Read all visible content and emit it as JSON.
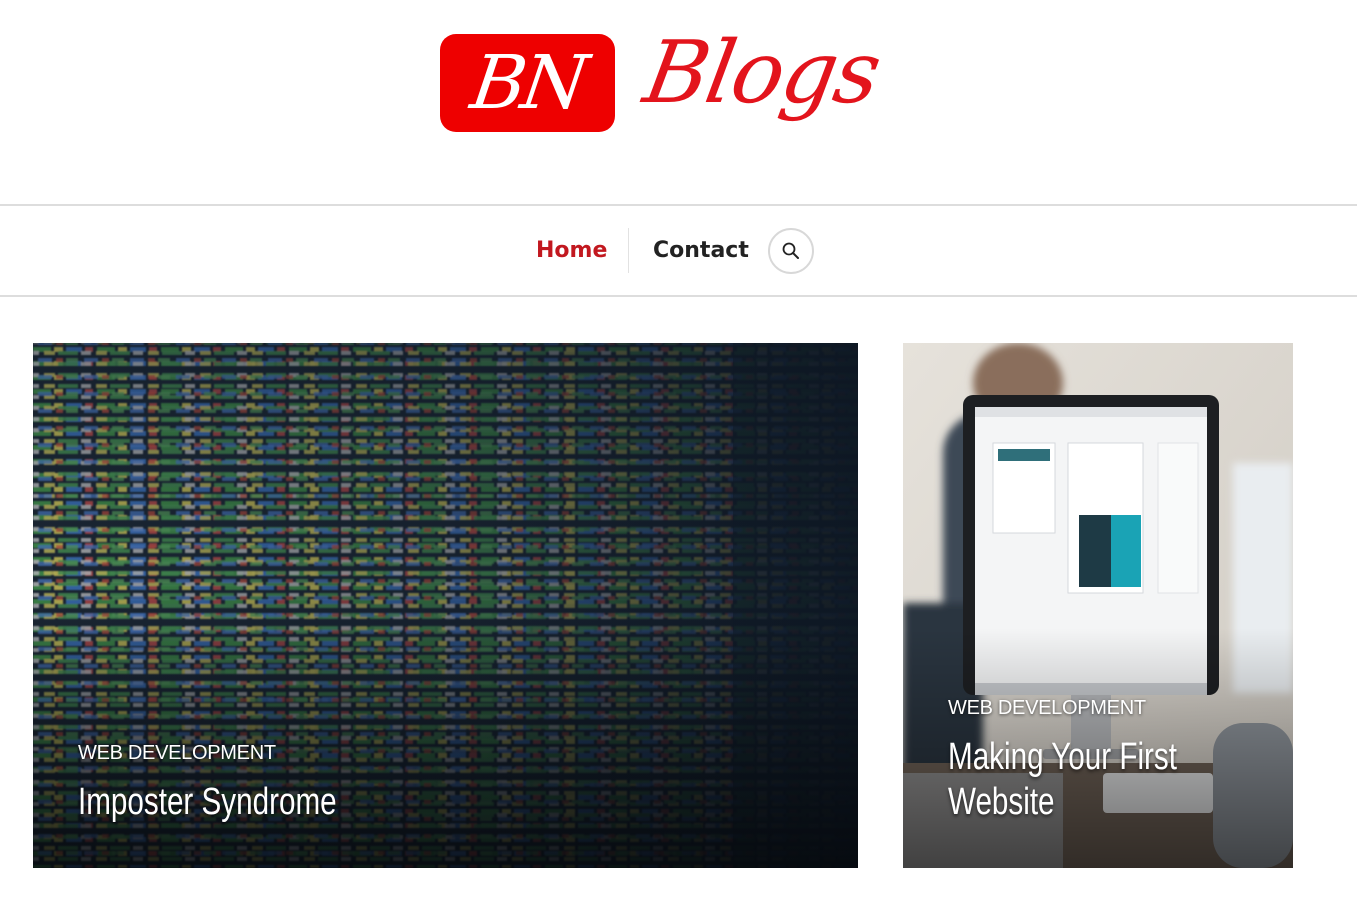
{
  "site": {
    "logo_badge_text": "BN",
    "logo_word_text": "Blogs",
    "brand_color": "#ee0000"
  },
  "nav": {
    "items": [
      {
        "label": "Home",
        "active": true
      },
      {
        "label": "Contact",
        "active": false
      }
    ],
    "search_icon": "search-icon",
    "active_color": "#c2181f"
  },
  "posts": [
    {
      "category": "WEB DEVELOPMENT",
      "title": "Imposter Syndrome",
      "image": "code-screen-photo"
    },
    {
      "category": "WEB DEVELOPMENT",
      "title_lines": [
        "Making Your First",
        "Website"
      ],
      "image": "desk-monitor-photo"
    }
  ]
}
